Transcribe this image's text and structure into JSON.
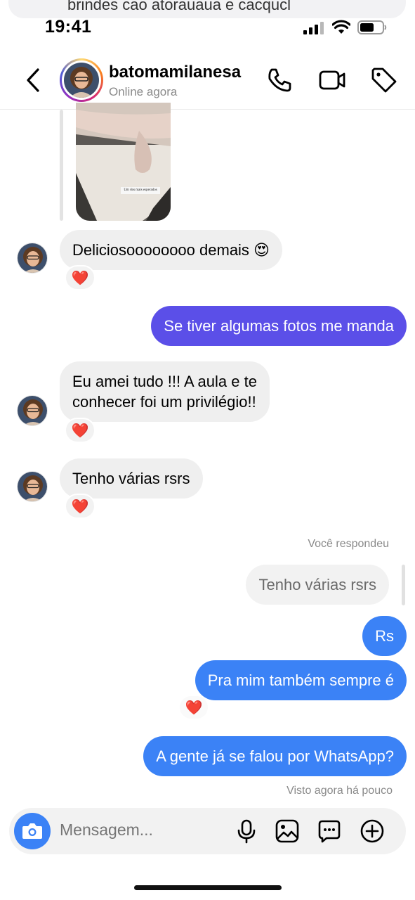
{
  "notification": {
    "text": "brindes cao atorauaua e cacqucl"
  },
  "status_bar": {
    "time": "19:41"
  },
  "header": {
    "username": "batomamilanesa",
    "status": "Online agora"
  },
  "shared_post": {
    "caption": "Um dos mais esperados"
  },
  "messages": [
    {
      "sender": "them",
      "text": "Deliciosoooooooo demais 😍",
      "reaction": "❤️"
    },
    {
      "sender": "me",
      "text": "Se tiver algumas fotos me manda"
    },
    {
      "sender": "them",
      "line1": "Eu amei tudo !!! A aula e te",
      "line2": "conhecer foi um privilégio!!",
      "reaction": "❤️"
    },
    {
      "sender": "them",
      "text": "Tenho várias rsrs",
      "reaction": "❤️"
    },
    {
      "sender": "me",
      "reply_label": "Você respondeu",
      "quoted": "Tenho várias rsrs",
      "text": "Rs"
    },
    {
      "sender": "me",
      "text": "Pra mim também sempre é",
      "reaction": "❤️"
    },
    {
      "sender": "me",
      "text": "A gente já se falou por WhatsApp?",
      "seen": "Visto agora há pouco"
    }
  ],
  "composer": {
    "placeholder": "Mensagem..."
  },
  "colors": {
    "purple": "#5b4fe8",
    "blue": "#3b82f6",
    "incoming": "#efefef"
  },
  "icons": [
    "back-icon",
    "phone-icon",
    "video-icon",
    "tag-icon",
    "camera-icon",
    "microphone-icon",
    "image-icon",
    "sticker-icon",
    "plus-icon",
    "heart-icon"
  ]
}
